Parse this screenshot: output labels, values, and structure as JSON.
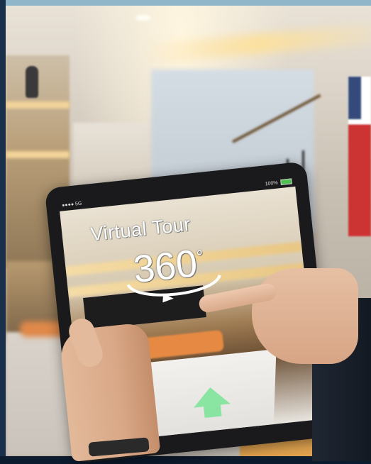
{
  "photo": {
    "description_subject": "photo",
    "tablet": {
      "status_left": "●●●● 5G",
      "status_right": "100%",
      "overlay_title": "Virtual Tour",
      "overlay_number": "360",
      "overlay_degree": "°"
    }
  },
  "colors": {
    "arrow": "#7fe39a",
    "accent_orange": "#e68a43",
    "art_red": "#cc3333"
  },
  "icons": {
    "rotation_arrow": "rotate-360-icon",
    "navigation_arrow": "arrow-up-icon",
    "battery": "battery-icon"
  }
}
